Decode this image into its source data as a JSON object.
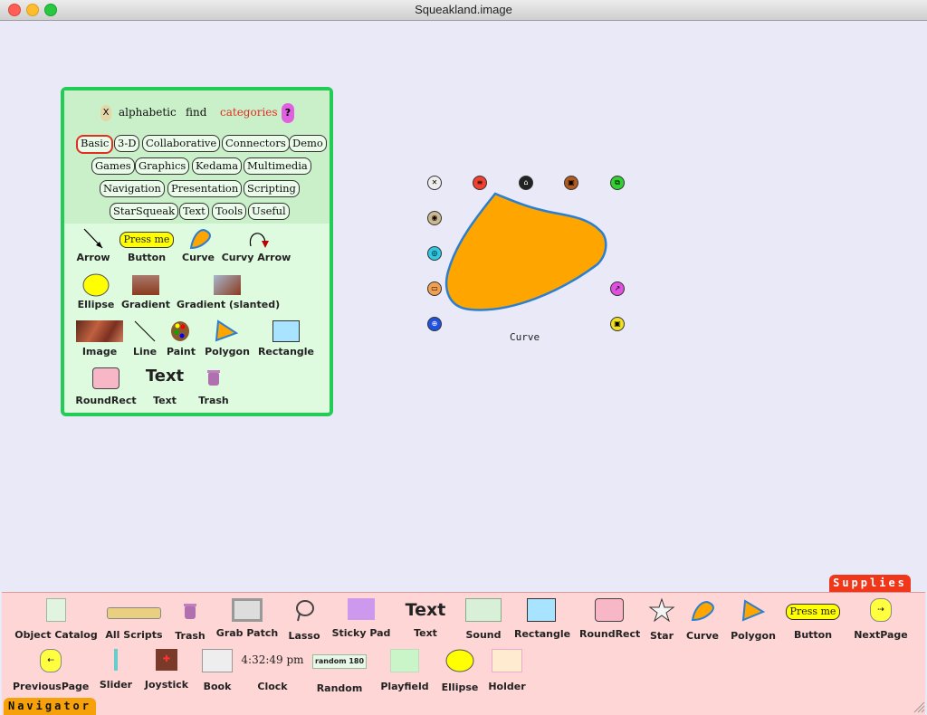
{
  "window": {
    "title": "Squeakland.image"
  },
  "catalog": {
    "close_label": "X",
    "help_label": "?",
    "tabs": {
      "alphabetic": "alphabetic",
      "find": "find",
      "categories": "categories"
    },
    "categories": [
      "Basic",
      "3-D",
      "Collaborative",
      "Connectors",
      "Demo",
      "Games",
      "Graphics",
      "Kedama",
      "Multimedia",
      "Navigation",
      "Presentation",
      "Scripting",
      "StarSqueak",
      "Text",
      "Tools",
      "Useful"
    ],
    "selected_category": "Basic",
    "items": {
      "arrow": "Arrow",
      "button": "Button",
      "button_face": "Press me",
      "curve": "Curve",
      "curvy_arrow": "Curvy Arrow",
      "ellipse": "Ellipse",
      "gradient": "Gradient",
      "gradient_slanted": "Gradient (slanted)",
      "image": "Image",
      "line": "Line",
      "paint": "Paint",
      "polygon": "Polygon",
      "rectangle": "Rectangle",
      "roundrect": "RoundRect",
      "text_face": "Text",
      "text": "Text",
      "trash": "Trash"
    }
  },
  "curve_object": {
    "name": "Curve",
    "color": "#ffa500",
    "border_color": "#2a7fd0"
  },
  "supplies": {
    "tab_label": "Supplies",
    "items": {
      "object_catalog": "Object Catalog",
      "all_scripts": "All Scripts",
      "trash": "Trash",
      "grab_patch": "Grab Patch",
      "lasso": "Lasso",
      "sticky_pad": "Sticky Pad",
      "text_face": "Text",
      "text": "Text",
      "sound": "Sound",
      "rectangle": "Rectangle",
      "roundrect": "RoundRect",
      "star": "Star",
      "curve": "Curve",
      "polygon": "Polygon",
      "button_face": "Press me",
      "button": "Button",
      "nextpage": "NextPage",
      "previouspage": "PreviousPage",
      "slider": "Slider",
      "joystick": "Joystick",
      "book": "Book",
      "clock_face": "4:32:49 pm",
      "clock": "Clock",
      "random_face": "random",
      "random_value": "180",
      "random": "Random",
      "playfield": "Playfield",
      "ellipse": "Ellipse",
      "holder": "Holder"
    }
  },
  "navigator": {
    "tab_label": "Navigator"
  }
}
